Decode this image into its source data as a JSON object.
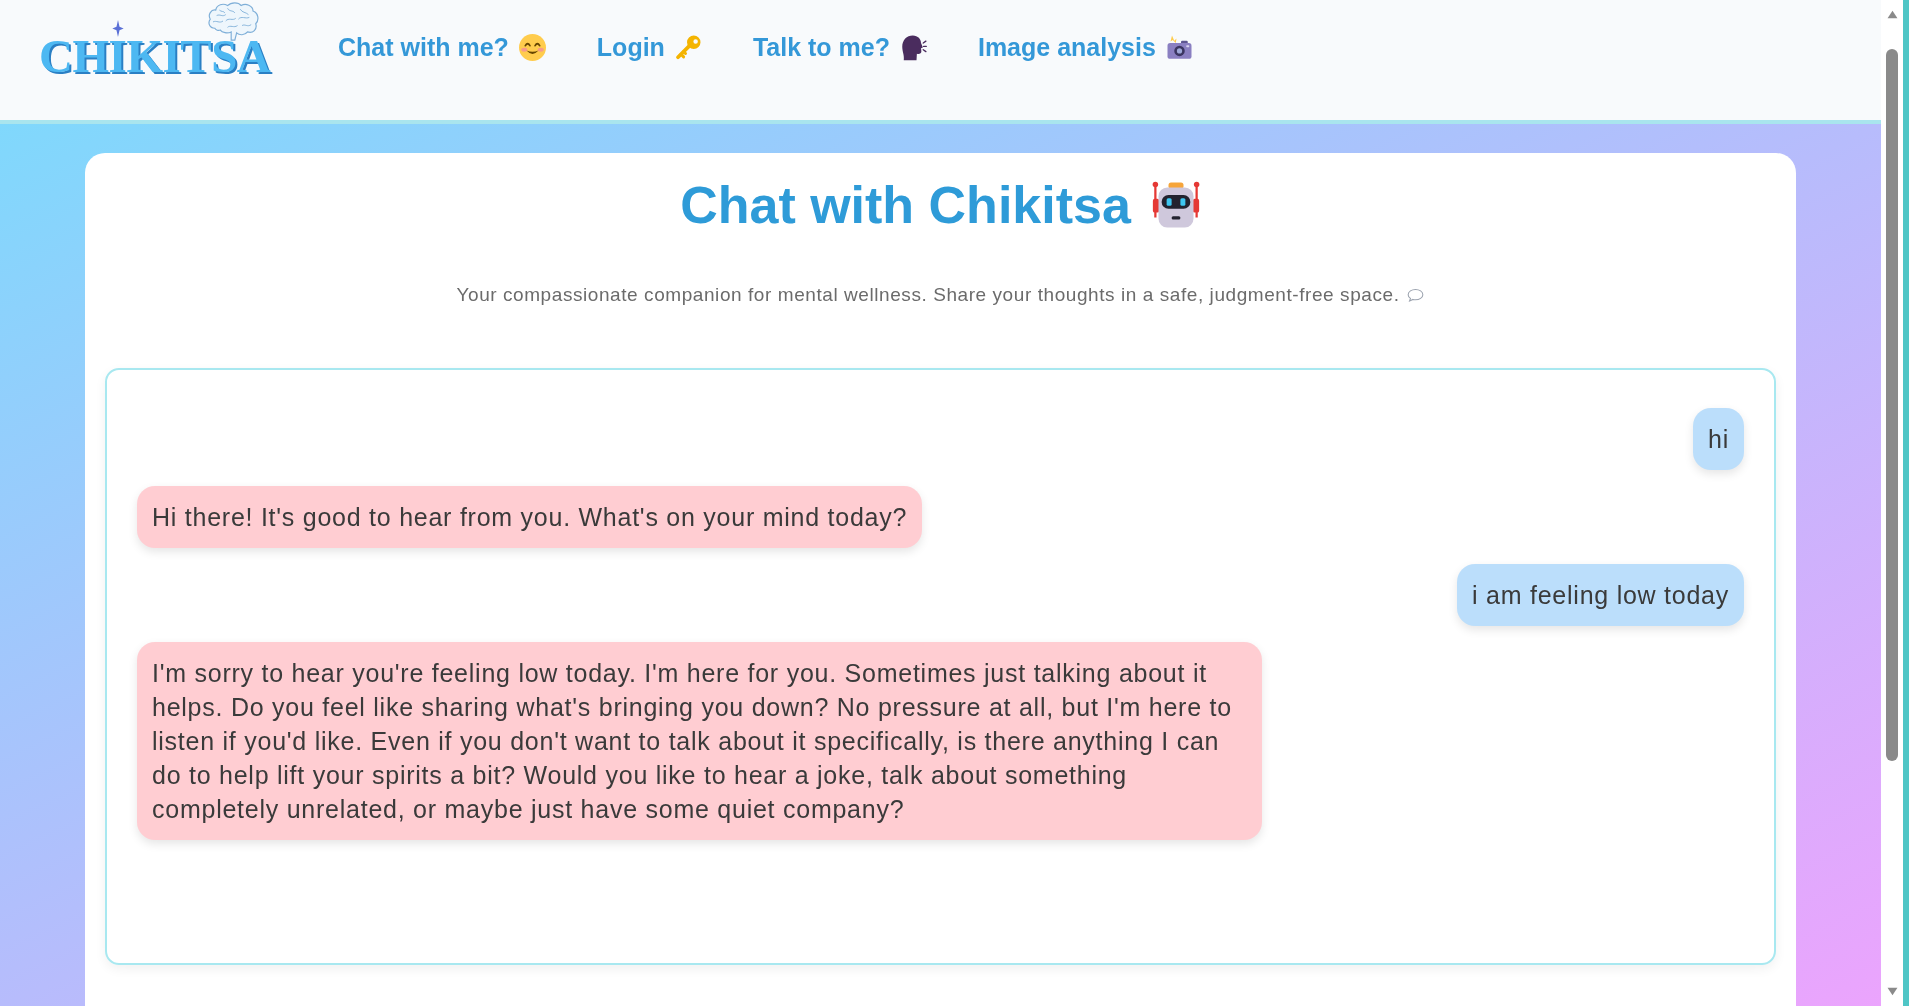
{
  "header": {
    "logo": {
      "text": "CHIKITSA"
    },
    "nav_links": [
      {
        "label": "Chat with me?"
      },
      {
        "label": "Login"
      },
      {
        "label": "Talk to me?"
      },
      {
        "label": "Image analysis"
      }
    ]
  },
  "card": {
    "title": "Chat with Chikitsa",
    "subtitle": "Your compassionate companion for mental wellness. Share your thoughts in a safe, judgment-free space.",
    "messages": [
      {
        "kind": "user",
        "text": "hi"
      },
      {
        "kind": "bot",
        "text": "Hi there! It's good to hear from you. What's on your mind today?"
      },
      {
        "kind": "user",
        "text": "i am feeling low today"
      },
      {
        "kind": "bot",
        "text": "I'm sorry to hear you're feeling low today. I'm here for you. Sometimes just talking about it helps. Do you feel like sharing what's bringing you down? No pressure at all, but I'm here to listen if you'd like. Even if you don't want to talk about it specifically, is there anything I can do to help lift your spirits a bit? Would you like to hear a joke, talk about something completely unrelated, or maybe just have some quiet company?"
      }
    ]
  }
}
